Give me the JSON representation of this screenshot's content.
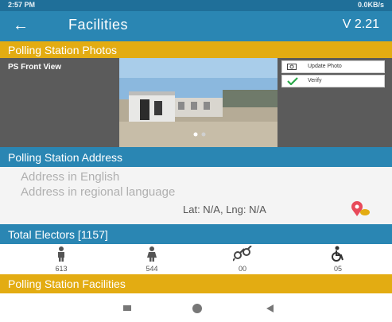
{
  "status_bar": {
    "time": "2:57 PM",
    "network_info": "0.0KB/s"
  },
  "app_bar": {
    "title": "Facilities",
    "version": "V 2.21",
    "back_icon": "arrow-left-icon"
  },
  "photos_section": {
    "header": "Polling Station Photos",
    "ps_label": "PS Front View",
    "update_photo_label": "Update Photo",
    "verify_label": "Verify"
  },
  "address_section": {
    "header": "Polling Station Address",
    "address_english_placeholder": "Address in English",
    "address_regional_placeholder": "Address in regional language",
    "lat_lng": "Lat: N/A, Lng: N/A"
  },
  "electors_section": {
    "header": "Total Electors [1157]",
    "items": [
      {
        "icon": "male-icon",
        "count": "613"
      },
      {
        "icon": "female-icon",
        "count": "544"
      },
      {
        "icon": "third-gender-icon",
        "count": "00"
      },
      {
        "icon": "wheelchair-icon",
        "count": "05"
      }
    ]
  },
  "facilities_section": {
    "header": "Polling Station Facilities"
  },
  "colors": {
    "primary": "#2a86b3",
    "accent": "#e3ac12",
    "status_bar": "#1f6f99"
  }
}
